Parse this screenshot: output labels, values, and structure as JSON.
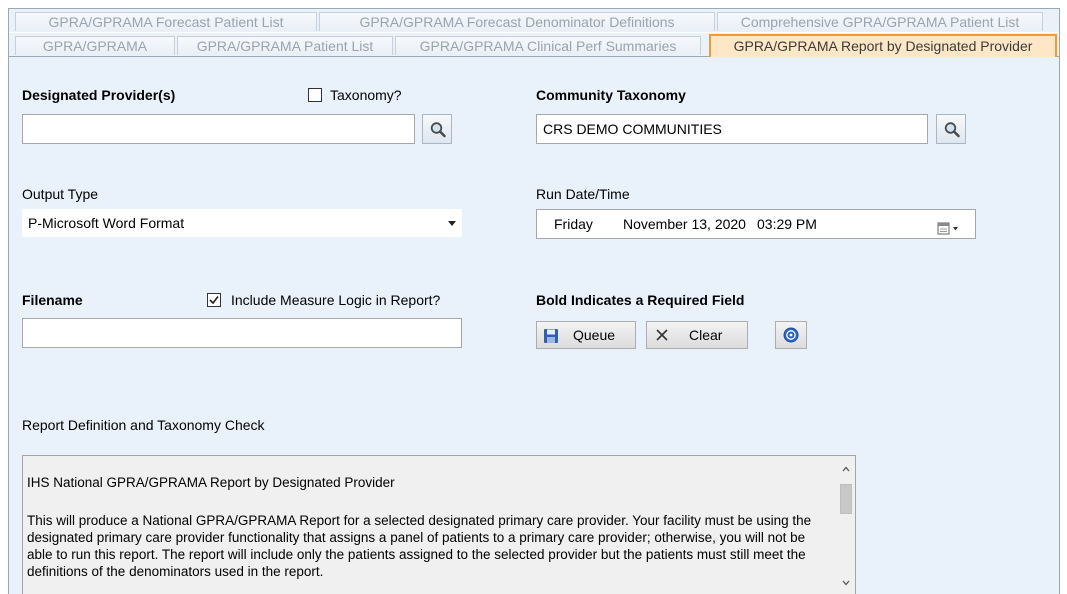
{
  "tabs": {
    "row1": [
      {
        "label": "GPRA/GPRAMA Forecast Patient List"
      },
      {
        "label": "GPRA/GPRAMA Forecast Denominator Definitions"
      },
      {
        "label": "Comprehensive GPRA/GPRAMA Patient List"
      }
    ],
    "row2": [
      {
        "label": "GPRA/GPRAMA"
      },
      {
        "label": "GPRA/GPRAMA Patient List"
      },
      {
        "label": "GPRA/GPRAMA Clinical Perf Summaries"
      },
      {
        "label": "GPRA/GPRAMA Report by Designated Provider",
        "active": true
      }
    ]
  },
  "form": {
    "designated_provider": {
      "label": "Designated Provider(s)",
      "value": ""
    },
    "taxonomy": {
      "label": "Taxonomy?",
      "checked": false
    },
    "community_taxonomy": {
      "label": "Community Taxonomy",
      "value": "CRS DEMO COMMUNITIES"
    },
    "output_type": {
      "label": "Output Type",
      "value": "P-Microsoft Word Format"
    },
    "run_datetime": {
      "label": "Run Date/Time",
      "day": "Friday",
      "date": "November 13, 2020",
      "time": "03:29 PM"
    },
    "filename": {
      "label": "Filename",
      "value": ""
    },
    "include_logic": {
      "label": "Include Measure Logic in Report?",
      "checked": true
    },
    "required_note": "Bold Indicates a Required Field",
    "queue_label": "Queue",
    "clear_label": "Clear"
  },
  "report": {
    "section_label": "Report Definition and Taxonomy Check",
    "title": "IHS National GPRA/GPRAMA Report by Designated Provider",
    "body": "This will produce a National GPRA/GPRAMA Report for a selected designated primary care provider.  Your facility must be using the designated primary care provider functionality that assigns a panel of patients to a primary care provider; otherwise, you will not be able to run this report.  The report will include only the patients assigned to the selected provider but the patients must still meet the definitions of the denominators used in the report."
  },
  "colors": {
    "active_tab_border": "#f39a2c",
    "active_tab_fill": "#fde7c6",
    "panel_background": "#e9f2fb"
  },
  "icons": [
    "search-icon",
    "calendar-icon",
    "save-icon",
    "close-icon",
    "help-icon"
  ]
}
